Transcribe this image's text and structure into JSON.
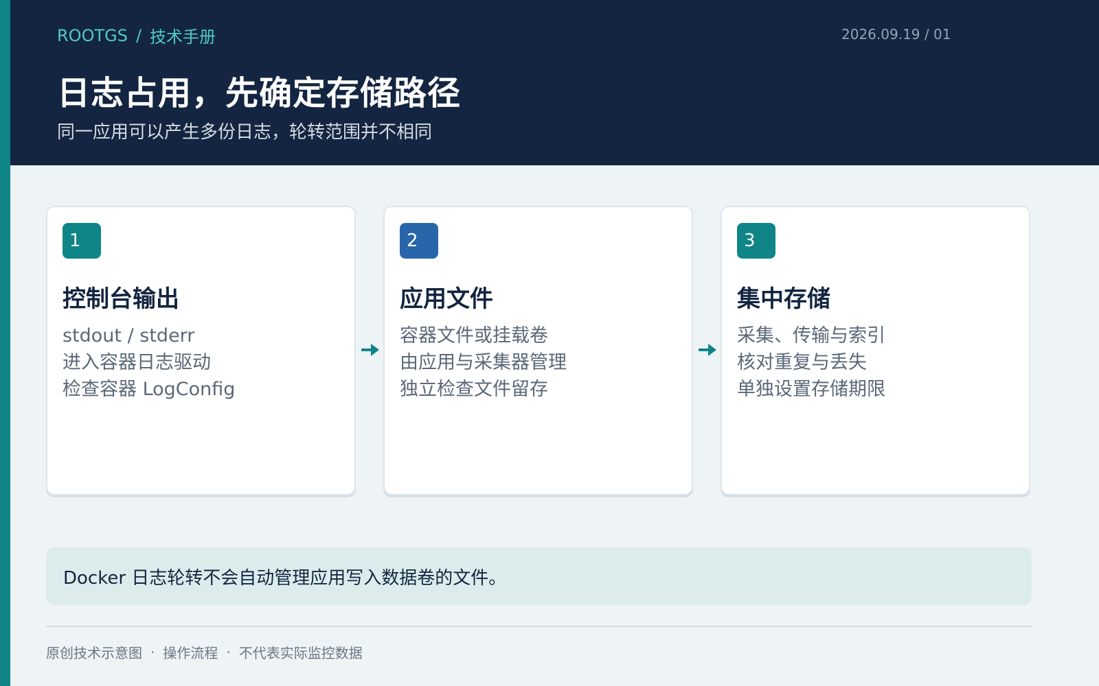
{
  "header": {
    "breadcrumb": {
      "brand": "ROOTGS",
      "separator": "/",
      "section": "技术手册"
    },
    "page_code": "2026.09.19 / 01",
    "title": "日志占用，先确定存储路径",
    "subtitle": "同一应用可以产生多份日志，轮转范围并不相同"
  },
  "steps": [
    {
      "number": "1",
      "title": "控制台输出",
      "lines": [
        "stdout / stderr",
        "进入容器日志驱动",
        "检查容器 LogConfig"
      ],
      "badge_color": "#0f8587"
    },
    {
      "number": "2",
      "title": "应用文件",
      "lines": [
        "容器文件或挂载卷",
        "由应用与采集器管理",
        "独立检查文件留存"
      ],
      "badge_color": "#2866a9"
    },
    {
      "number": "3",
      "title": "集中存储",
      "lines": [
        "采集、传输与索引",
        "核对重复与丢失",
        "单独设置存储期限"
      ],
      "badge_color": "#0f8587"
    }
  ],
  "connector_icon": "arrow-right-icon",
  "note": "Docker 日志轮转不会自动管理应用写入数据卷的文件。",
  "footer": {
    "items": [
      "原创技术示意图",
      "操作流程",
      "不代表实际监控数据"
    ],
    "separator": "·"
  },
  "colors": {
    "header_bg": "#132540",
    "accent": "#0f8587",
    "breadcrumb": "#52c9c5",
    "blue": "#2866a9",
    "page_bg": "#eef3f6",
    "note_bg": "#dcecec"
  }
}
